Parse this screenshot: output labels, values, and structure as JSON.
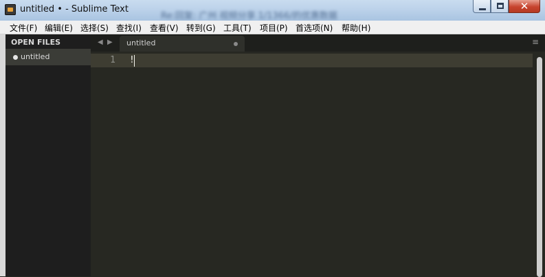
{
  "window": {
    "title": "untitled • - Sublime Text",
    "background_text": "Re:回复: 广州 视频分享  1/1366/的优惠数据",
    "close_glyph": "✕"
  },
  "menu": {
    "items": [
      "文件(F)",
      "编辑(E)",
      "选择(S)",
      "查找(I)",
      "查看(V)",
      "转到(G)",
      "工具(T)",
      "项目(P)",
      "首选项(N)",
      "帮助(H)"
    ]
  },
  "sidebar": {
    "header": "OPEN FILES",
    "files": [
      "untitled"
    ]
  },
  "tabs": {
    "nav_back": "◀",
    "nav_forward": "▶",
    "active_label": "untitled",
    "menu_glyph": "≡"
  },
  "editor": {
    "line_number": "1",
    "content": "!"
  },
  "colors": {
    "editor_bg": "#272822",
    "sidebar_bg": "#1e1e1e",
    "line_highlight": "#3e3d32"
  }
}
